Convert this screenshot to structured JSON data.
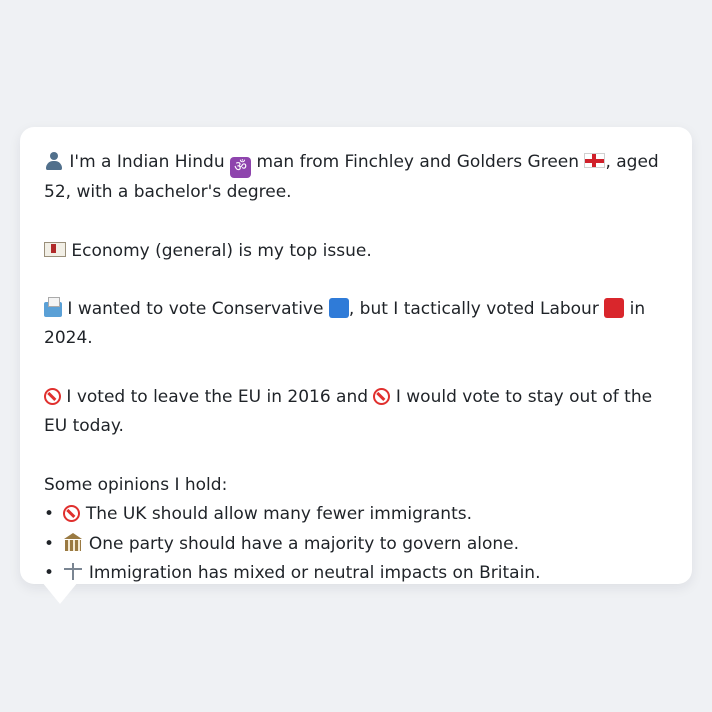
{
  "profile": {
    "intro": {
      "p1": "I'm a Indian Hindu",
      "p2": "man from Finchley and Golders Green",
      "p3": ", aged 52,",
      "p4": "with a bachelor's degree."
    },
    "issue": "Economy (general) is my top issue.",
    "vote": {
      "p1": "I wanted to vote Conservative",
      "p2": ", but I tactically voted Labour",
      "p3": "in 2024."
    },
    "eu": {
      "p1": "I voted to leave the EU in 2016 and",
      "p2": "I would vote to stay out of the EU",
      "p3": "today."
    },
    "opinions_heading": "Some opinions I hold:",
    "opinions": [
      "The UK should allow many fewer immigrants.",
      "One party should have a majority to govern alone.",
      "Immigration has mixed or neutral impacts on Britain."
    ]
  },
  "icons": {
    "person": "bust-in-silhouette-icon",
    "om": "om-symbol-icon",
    "flag": "england-flag-icon",
    "issue": "money-icon",
    "ballot": "ballot-box-icon",
    "conservative": "blue-square-icon",
    "labour": "red-square-icon",
    "no_entry": "prohibited-icon",
    "bank": "classical-building-icon",
    "scales": "balance-scale-icon"
  },
  "colors": {
    "background": "#eff1f4",
    "bubble": "#ffffff",
    "text": "#1f2328",
    "conservative": "#2f7bd8",
    "labour": "#d9262c"
  }
}
